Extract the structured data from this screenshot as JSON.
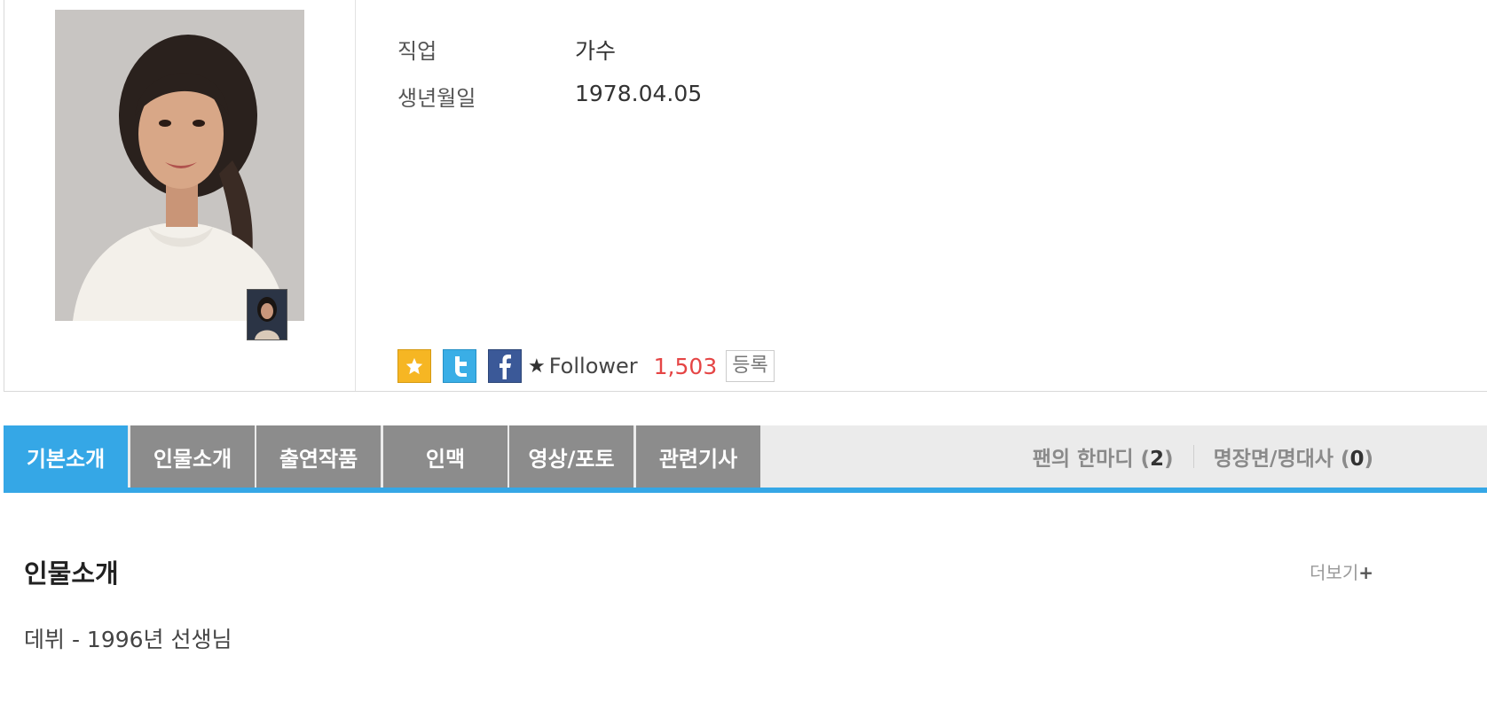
{
  "profile": {
    "fields": [
      {
        "key": "직업",
        "value": "가수"
      },
      {
        "key": "생년월일",
        "value": "1978.04.05"
      }
    ],
    "social": {
      "icons": [
        "star-icon",
        "twitter-icon",
        "facebook-icon"
      ],
      "follower_label": "Follower",
      "follower_count": "1,503",
      "register_label": "등록"
    }
  },
  "tabs": [
    {
      "label": "기본소개",
      "active": true
    },
    {
      "label": "인물소개",
      "active": false
    },
    {
      "label": "출연작품",
      "active": false
    },
    {
      "label": "인맥",
      "active": false
    },
    {
      "label": "영상/포토",
      "active": false
    },
    {
      "label": "관련기사",
      "active": false
    }
  ],
  "right_links": {
    "fan_comment_label": "팬의 한마디",
    "fan_comment_count": "2",
    "quotes_label": "명장면/명대사",
    "quotes_count": "0"
  },
  "section": {
    "title": "인물소개",
    "more_label": "더보기",
    "text": "데뷔 - 1996년 선생님"
  },
  "colors": {
    "accent": "#35a7e6",
    "tab_inactive": "#8c8c8c",
    "follower_count": "#e54545"
  }
}
